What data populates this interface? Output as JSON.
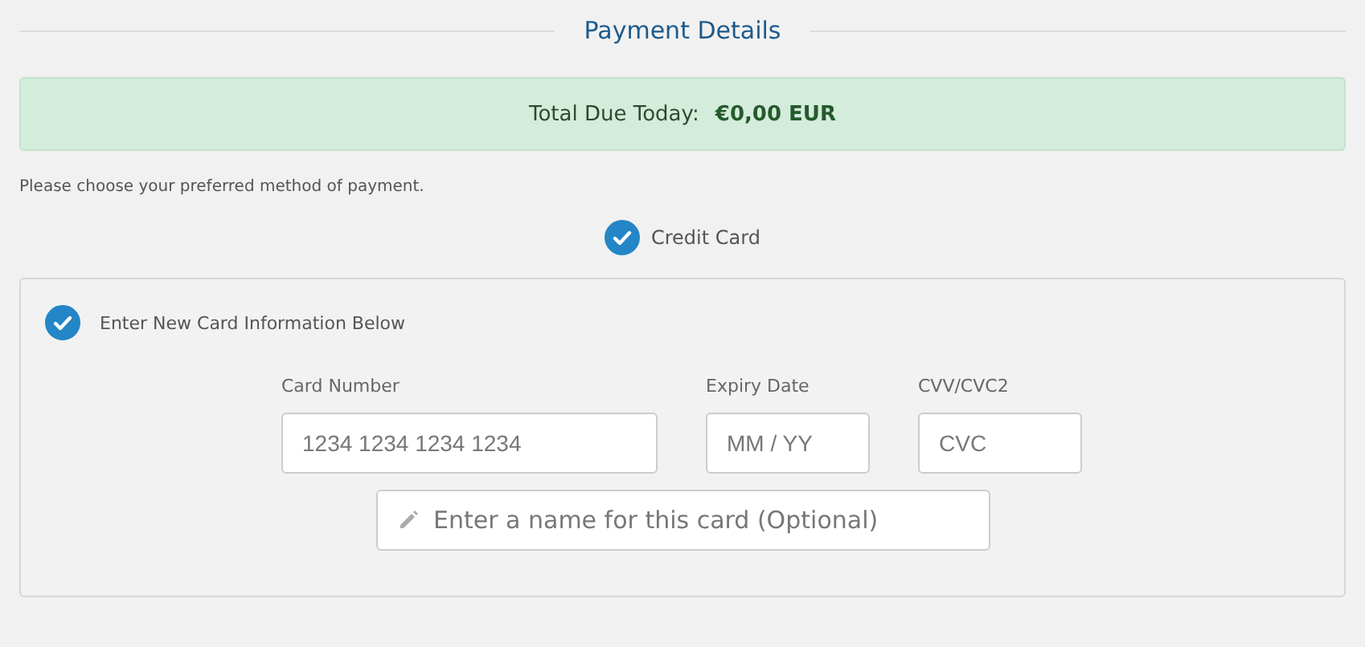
{
  "heading": "Payment Details",
  "total": {
    "label": "Total Due Today:",
    "amount": "€0,00 EUR"
  },
  "instructions": "Please choose your preferred method of payment.",
  "payment_methods": [
    {
      "label": "Credit Card",
      "selected": true
    }
  ],
  "card_options": [
    {
      "label": "Enter New Card Information Below",
      "selected": true
    }
  ],
  "fields": [
    {
      "label": "Card Number",
      "placeholder": "1234 1234 1234 1234",
      "kind": "wide"
    },
    {
      "label": "Expiry Date",
      "placeholder": "MM / YY",
      "kind": "short"
    },
    {
      "label": "CVV/CVC2",
      "placeholder": "CVC",
      "kind": "short"
    }
  ],
  "card_name": {
    "placeholder": "Enter a name for this card (Optional)"
  }
}
